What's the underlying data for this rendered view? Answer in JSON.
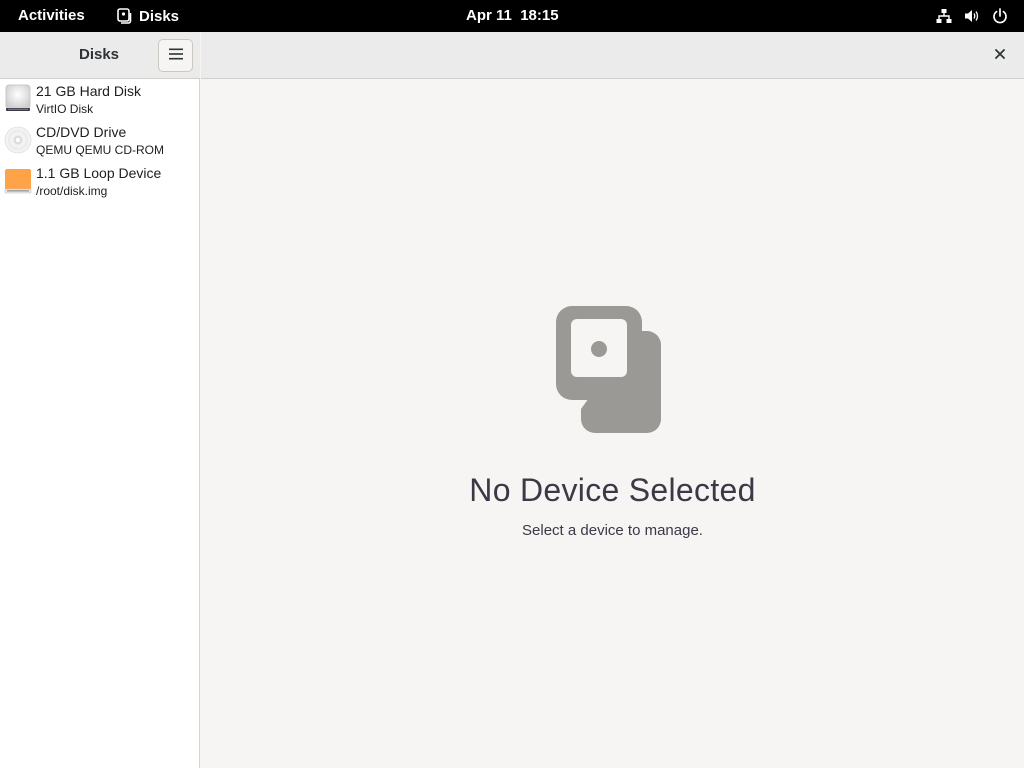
{
  "topbar": {
    "activities": "Activities",
    "app_name": "Disks",
    "clock": "Apr 11  18:15",
    "tray_icons": [
      "network-icon",
      "volume-icon",
      "power-icon"
    ]
  },
  "sidebar": {
    "title": "Disks",
    "menu_icon": "hamburger-menu-icon",
    "devices": [
      {
        "name": "21 GB Hard Disk",
        "subtitle": "VirtIO Disk",
        "icon": "hard-disk-icon"
      },
      {
        "name": "CD/DVD Drive",
        "subtitle": "QEMU QEMU CD-ROM",
        "icon": "optical-drive-icon"
      },
      {
        "name": "1.1 GB Loop Device",
        "subtitle": "/root/disk.img",
        "icon": "loop-device-icon"
      }
    ]
  },
  "main": {
    "close_icon": "close-icon",
    "empty_title": "No Device Selected",
    "empty_subtitle": "Select a device to manage."
  },
  "colors": {
    "topbar_bg": "#000000",
    "window_bg": "#f6f5f4",
    "header_bg": "#ebebeb",
    "loop_device_accent": "#ffa348",
    "empty_icon": "#9a9996"
  }
}
